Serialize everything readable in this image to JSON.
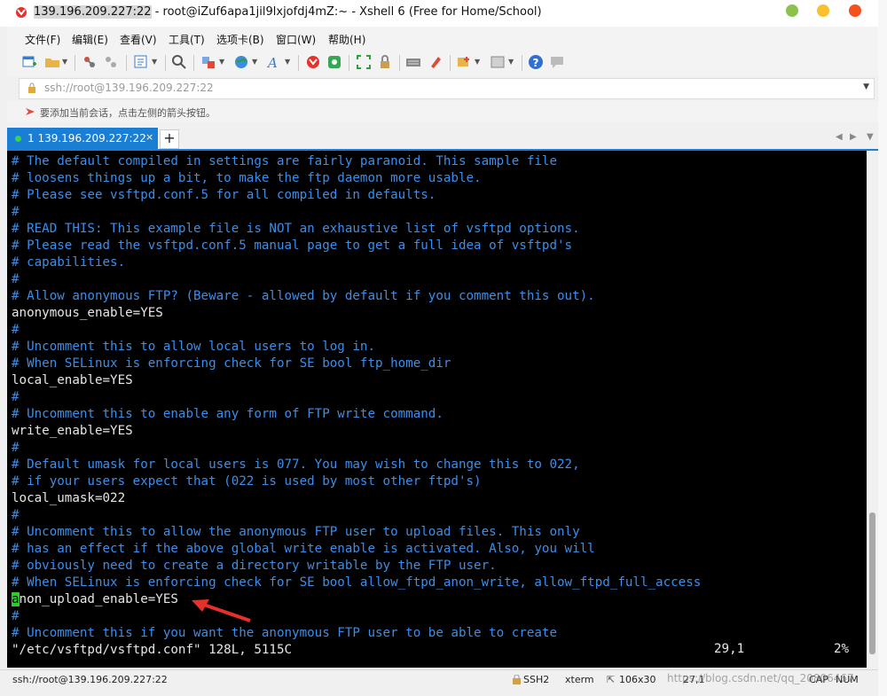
{
  "window": {
    "title_host": "139.196.209.227:22",
    "title_rest": " - root@iZuf6apa1jil9lxjofdj4mZ:~ - Xshell 6 (Free for Home/School)"
  },
  "menu": [
    "文件(F)",
    "编辑(E)",
    "查看(V)",
    "工具(T)",
    "选项卡(B)",
    "窗口(W)",
    "帮助(H)"
  ],
  "address": {
    "value": "ssh://root@139.196.209.227:22"
  },
  "hint": "要添加当前会话，点击左侧的箭头按钮。",
  "tabs": [
    {
      "label": "1 139.196.209.227:22",
      "close": "×"
    }
  ],
  "tab_add": "+",
  "terminal": {
    "lines": [
      {
        "t": "# The default compiled in settings are fairly paranoid. This sample file",
        "c": "comment"
      },
      {
        "t": "# loosens things up a bit, to make the ftp daemon more usable.",
        "c": "comment"
      },
      {
        "t": "# Please see vsftpd.conf.5 for all compiled in defaults.",
        "c": "comment"
      },
      {
        "t": "#",
        "c": "comment"
      },
      {
        "t": "# READ THIS: This example file is NOT an exhaustive list of vsftpd options.",
        "c": "comment"
      },
      {
        "t": "# Please read the vsftpd.conf.5 manual page to get a full idea of vsftpd's",
        "c": "comment"
      },
      {
        "t": "# capabilities.",
        "c": "comment"
      },
      {
        "t": "#",
        "c": "comment"
      },
      {
        "t": "# Allow anonymous FTP? (Beware - allowed by default if you comment this out).",
        "c": "comment"
      },
      {
        "t": "anonymous_enable=YES",
        "c": "text"
      },
      {
        "t": "#",
        "c": "comment"
      },
      {
        "t": "# Uncomment this to allow local users to log in.",
        "c": "comment"
      },
      {
        "t": "# When SELinux is enforcing check for SE bool ftp_home_dir",
        "c": "comment"
      },
      {
        "t": "local_enable=YES",
        "c": "text"
      },
      {
        "t": "#",
        "c": "comment"
      },
      {
        "t": "# Uncomment this to enable any form of FTP write command.",
        "c": "comment"
      },
      {
        "t": "write_enable=YES",
        "c": "text"
      },
      {
        "t": "#",
        "c": "comment"
      },
      {
        "t": "# Default umask for local users is 077. You may wish to change this to 022,",
        "c": "comment"
      },
      {
        "t": "# if your users expect that (022 is used by most other ftpd's)",
        "c": "comment"
      },
      {
        "t": "local_umask=022",
        "c": "text"
      },
      {
        "t": "#",
        "c": "comment"
      },
      {
        "t": "# Uncomment this to allow the anonymous FTP user to upload files. This only",
        "c": "comment"
      },
      {
        "t": "# has an effect if the above global write enable is activated. Also, you will",
        "c": "comment"
      },
      {
        "t": "# obviously need to create a directory writable by the FTP user.",
        "c": "comment"
      },
      {
        "t": "# When SELinux is enforcing check for SE bool allow_ftpd_anon_write, allow_ftpd_full_access",
        "c": "comment"
      },
      {
        "t": "anon_upload_enable=YES",
        "c": "text",
        "cursor": true
      },
      {
        "t": "#",
        "c": "comment"
      },
      {
        "t": "# Uncomment this if you want the anonymous FTP user to be able to create",
        "c": "comment"
      },
      {
        "t": "\"/etc/vsftpd/vsftpd.conf\" 128L, 5115C",
        "c": "text"
      }
    ],
    "cursor_pos": "29,1",
    "scroll_pct": "2%"
  },
  "statusbar": {
    "conn": "ssh://root@139.196.209.227:22",
    "proto": "SSH2",
    "term": "xterm",
    "size": "106x30",
    "pos": "27,1",
    "caps": "CAP",
    "num": "NUM"
  },
  "watermark": "https://blog.csdn.net/qq_20806467",
  "colors": {
    "terminal_bg": "#000000",
    "comment": "#3b8eea",
    "text": "#e6e6e6",
    "cursor": "#2ad02a",
    "tab_accent": "#1a7fd4",
    "arrow": "#e8302a"
  },
  "icons": [
    "xshell-logo-icon",
    "new-session-icon",
    "open-folder-icon",
    "connect-icon",
    "disconnect-icon",
    "properties-icon",
    "find-icon",
    "transfer-icon",
    "globe-icon",
    "font-icon",
    "xshell-icon",
    "xftp-icon",
    "fullscreen-icon",
    "lock-icon",
    "keyboard-icon",
    "highlight-icon",
    "new-tab-icon",
    "layout-icon",
    "help-icon",
    "chat-icon"
  ]
}
